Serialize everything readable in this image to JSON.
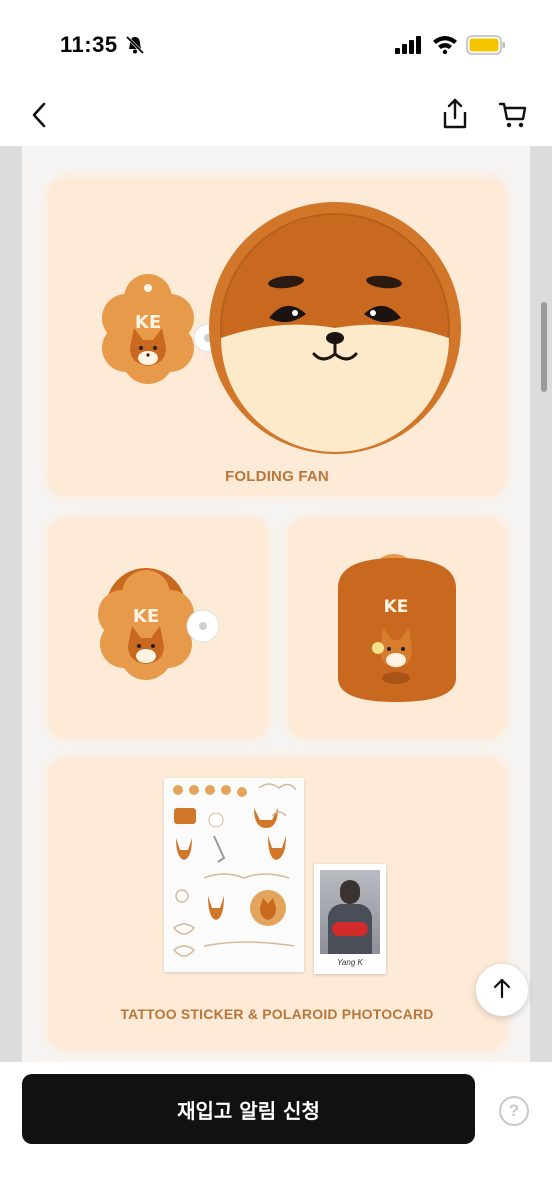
{
  "status_bar": {
    "time": "11:35"
  },
  "nav": {
    "back": "back",
    "share": "share",
    "cart": "cart"
  },
  "product_images": {
    "fan_caption": "FOLDING FAN",
    "ke_label": "KE",
    "sticker_caption": "TATTOO STICKER & POLAROID PHOTOCARD",
    "polaroid_signature": "Yang K"
  },
  "bottom_bar": {
    "restock_label": "재입고 알림 신청",
    "help_symbol": "?"
  },
  "colors": {
    "fox_orange": "#d2762a",
    "panel_bg": "#fdebd8",
    "caption": "#b8763b",
    "button_bg": "#111111"
  }
}
